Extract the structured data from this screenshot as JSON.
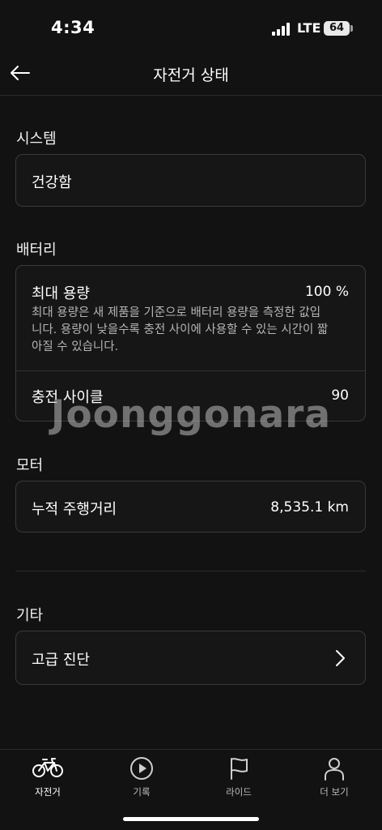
{
  "status_bar": {
    "time": "4:34",
    "network": "LTE",
    "battery_level": "64"
  },
  "header": {
    "title": "자전거 상태"
  },
  "system": {
    "section_title": "시스템",
    "status_value": "건강함"
  },
  "battery": {
    "section_title": "배터리",
    "max_capacity_label": "최대 용량",
    "max_capacity_value": "100 %",
    "max_capacity_desc": "최대 용량은 새 제품을 기준으로 배터리 용량을 측정한 값입니다. 용량이 낮을수록 충전 사이에 사용할 수 있는 시간이 짧아질 수 있습니다.",
    "charge_cycle_label": "충전 사이클",
    "charge_cycle_value": "90"
  },
  "motor": {
    "section_title": "모터",
    "odometer_label": "누적 주행거리",
    "odometer_value": "8,535.1 km"
  },
  "etc": {
    "section_title": "기타",
    "advanced_diagnostics_label": "고급 진단"
  },
  "watermark": "Joonggonara",
  "tabbar": {
    "tabs": [
      {
        "label": "자전거",
        "icon": "bicycle-icon",
        "active": true
      },
      {
        "label": "기록",
        "icon": "play-circle-icon",
        "active": false
      },
      {
        "label": "라이드",
        "icon": "flag-icon",
        "active": false
      },
      {
        "label": "더 보기",
        "icon": "person-icon",
        "active": false
      }
    ]
  },
  "colors": {
    "background": "#121212",
    "card_border": "#3a3a3a",
    "text_primary": "#ffffff",
    "text_secondary": "#b5b5b5"
  }
}
